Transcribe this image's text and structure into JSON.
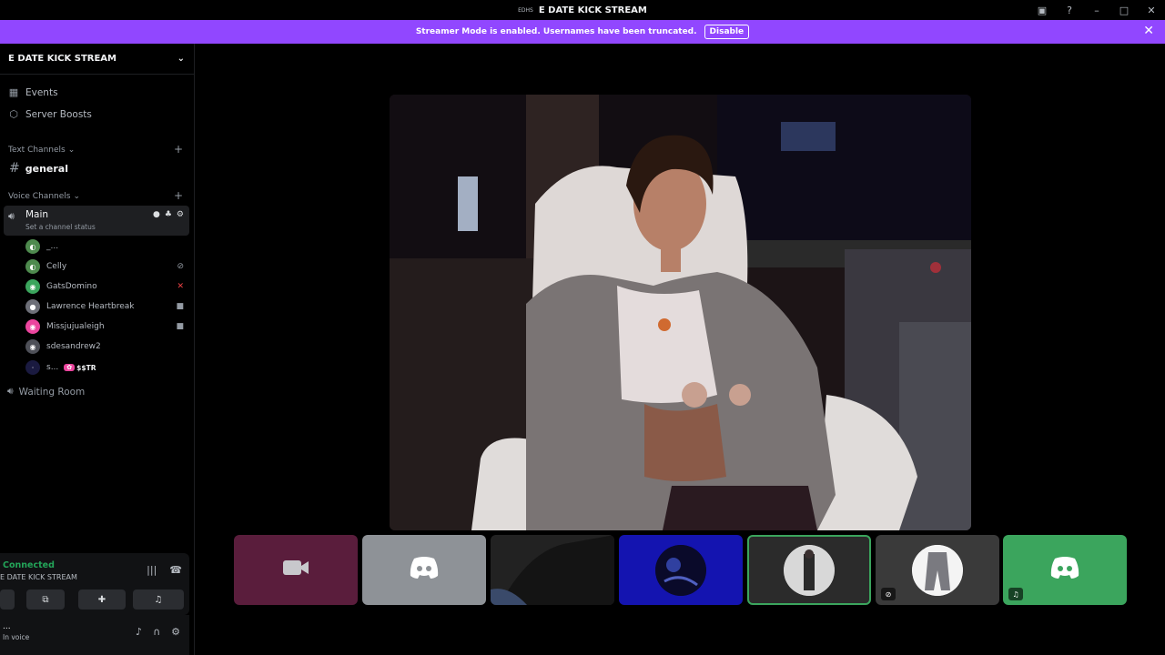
{
  "window": {
    "title_tag": "EDHS",
    "title": "E DATE KICK STREAM"
  },
  "banner": {
    "text": "Streamer Mode is enabled. Usernames have been truncated.",
    "disable_label": "Disable"
  },
  "server": {
    "name": "E DATE KICK STREAM"
  },
  "nav": {
    "events_label": "Events",
    "boosts_label": "Server Boosts"
  },
  "categories": {
    "text": "Text Channels",
    "voice": "Voice Channels"
  },
  "text_channel": {
    "name": "general"
  },
  "voice_main": {
    "name": "Main",
    "status": "Set a channel status"
  },
  "members": [
    {
      "name": "_..."
    },
    {
      "name": "Celly"
    },
    {
      "name": "GatsDomino"
    },
    {
      "name": "Lawrence Heartbreak"
    },
    {
      "name": "Missjujualeigh"
    },
    {
      "name": "sdesandrew2"
    },
    {
      "name": "s...",
      "tag": "$$TR"
    }
  ],
  "waiting_room": {
    "name": "Waiting Room"
  },
  "voice_panel": {
    "status": "Connected",
    "channel": "E DATE KICK STREAM"
  },
  "user_panel": {
    "name": "...",
    "status": "In voice"
  },
  "colors": {
    "accent": "#9147ff",
    "connected": "#23a559",
    "discord_blurple": "#5865f2",
    "tile_green": "#3ba55d"
  },
  "icons": [
    "screen-icon",
    "help-icon",
    "minimize-icon",
    "maximize-icon",
    "close-icon",
    "camera-icon",
    "discord-logo-icon",
    "deafen-icon"
  ]
}
